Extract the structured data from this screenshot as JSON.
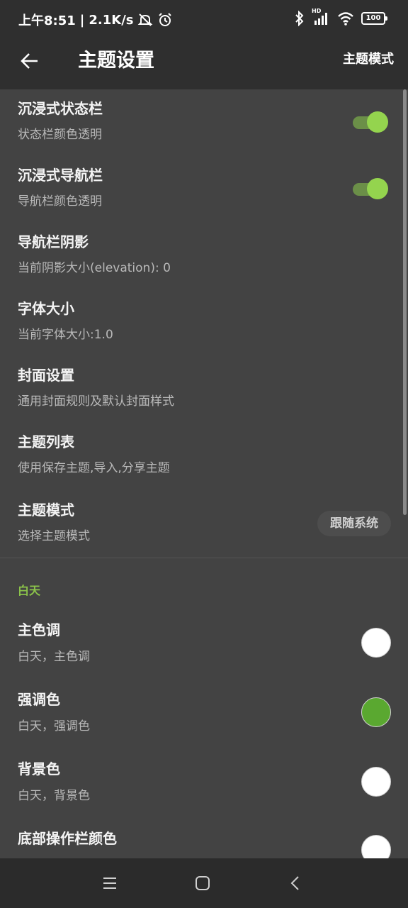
{
  "status_bar": {
    "time": "上午8:51",
    "separator": "|",
    "net_speed": "2.1K/s",
    "hd_label": "HD",
    "battery": "100"
  },
  "app_bar": {
    "title": "主题设置",
    "action": "主题模式"
  },
  "settings": [
    {
      "title": "沉浸式状态栏",
      "subtitle": "状态栏颜色透明",
      "switch_on": true
    },
    {
      "title": "沉浸式导航栏",
      "subtitle": "导航栏颜色透明",
      "switch_on": true
    },
    {
      "title": "导航栏阴影",
      "subtitle": "当前阴影大小(elevation): 0"
    },
    {
      "title": "字体大小",
      "subtitle": "当前字体大小:1.0"
    },
    {
      "title": "封面设置",
      "subtitle": "通用封面规则及默认封面样式"
    },
    {
      "title": "主题列表",
      "subtitle": "使用保存主题,导入,分享主题"
    },
    {
      "title": "主题模式",
      "subtitle": "选择主题模式",
      "value": "跟随系统"
    }
  ],
  "day_section": {
    "header": "白天",
    "header_color": "#8bc34a",
    "items": [
      {
        "title": "主色调",
        "subtitle": "白天，主色调",
        "color": "#ffffff"
      },
      {
        "title": "强调色",
        "subtitle": "白天，强调色",
        "color": "#5aa830"
      },
      {
        "title": "背景色",
        "subtitle": "白天，背景色",
        "color": "#ffffff"
      },
      {
        "title": "底部操作栏颜色",
        "subtitle": "",
        "color": "#ffffff"
      }
    ]
  },
  "colors": {
    "switch_track": "#6b8f48",
    "switch_thumb": "#94d44e",
    "background": "#434343",
    "bar": "#2f2f2f"
  },
  "icons": {
    "back": "arrow-left-icon",
    "menu": "menu-lines-icon",
    "home": "square-home-icon",
    "nav_back": "chevron-left-icon"
  }
}
